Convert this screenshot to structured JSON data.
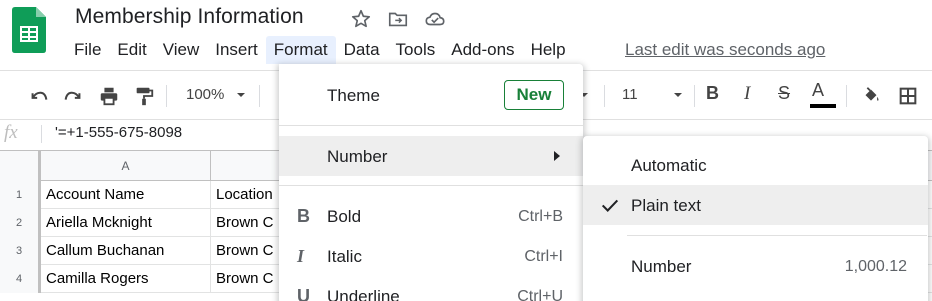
{
  "app": {
    "title": "Membership Information",
    "last_edit": "Last edit was seconds ago"
  },
  "menubar": [
    "File",
    "Edit",
    "View",
    "Insert",
    "Format",
    "Data",
    "Tools",
    "Add-ons",
    "Help"
  ],
  "toolbar": {
    "zoom": "100%",
    "font_size": "11",
    "bold": "B",
    "italic": "I",
    "strike": "S",
    "text_color": "A"
  },
  "formula_bar": {
    "fx": "fx",
    "value": "'=+1-555-675-8098"
  },
  "grid": {
    "columns": [
      "A",
      ""
    ],
    "rows": [
      {
        "num": "1",
        "a": "Account Name",
        "b": "Location"
      },
      {
        "num": "2",
        "a": "Ariella Mcknight",
        "b": "Brown C"
      },
      {
        "num": "3",
        "a": "Callum Buchanan",
        "b": "Brown C"
      },
      {
        "num": "4",
        "a": "Camilla Rogers",
        "b": "Brown C"
      }
    ]
  },
  "format_menu": {
    "theme": "Theme",
    "new_badge": "New",
    "number": "Number",
    "bold": "Bold",
    "bold_shortcut": "Ctrl+B",
    "italic": "Italic",
    "italic_shortcut": "Ctrl+I",
    "underline": "Underline",
    "underline_shortcut": "Ctrl+U"
  },
  "number_menu": {
    "automatic": "Automatic",
    "plain_text": "Plain text",
    "number": "Number",
    "number_sample": "1,000.12"
  },
  "colors": {
    "accent_green": "#188038",
    "menu_highlight": "#eeeeee",
    "active_menu": "#e8f0fe"
  }
}
